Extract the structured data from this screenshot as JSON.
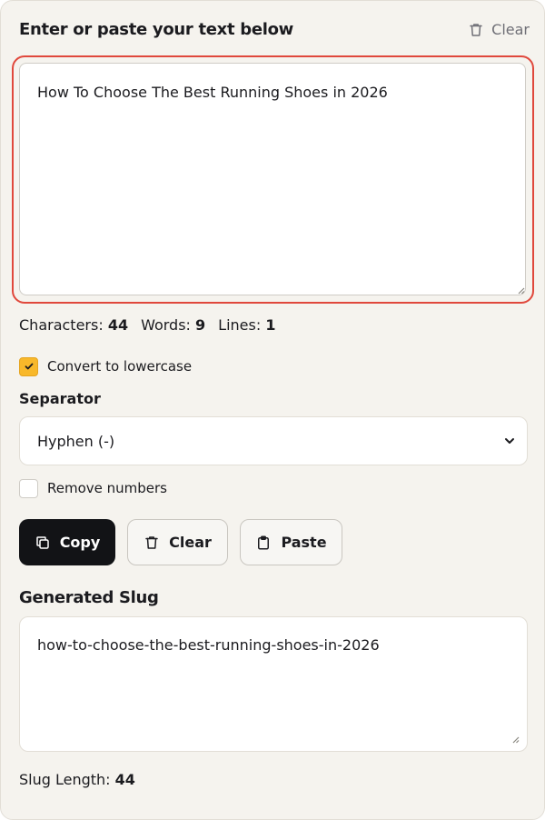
{
  "header": {
    "title": "Enter or paste your text below",
    "clear_label": "Clear"
  },
  "input": {
    "value": "How To Choose The Best Running Shoes in 2026",
    "focus_color": "#e0483c"
  },
  "stats": {
    "characters_label": "Characters:",
    "characters_value": "44",
    "words_label": "Words:",
    "words_value": "9",
    "lines_label": "Lines:",
    "lines_value": "1"
  },
  "options": {
    "lowercase_label": "Convert to lowercase",
    "lowercase_checked": true,
    "separator_label": "Separator",
    "separator_value": "Hyphen (-)",
    "remove_numbers_label": "Remove numbers",
    "remove_numbers_checked": false,
    "checkbox_color": "#f8b82a"
  },
  "actions": {
    "copy_label": "Copy",
    "clear_label": "Clear",
    "paste_label": "Paste"
  },
  "output": {
    "title": "Generated Slug",
    "slug": "how-to-choose-the-best-running-shoes-in-2026",
    "length_label": "Slug Length:",
    "length_value": "44"
  },
  "icons": {
    "header_clear": "trash-icon",
    "resize": "resize-grip-icon",
    "check": "checkmark-icon",
    "select": "chevron-down-icon",
    "copy": "copy-icon",
    "clear": "trash-icon",
    "paste": "clipboard-icon"
  }
}
